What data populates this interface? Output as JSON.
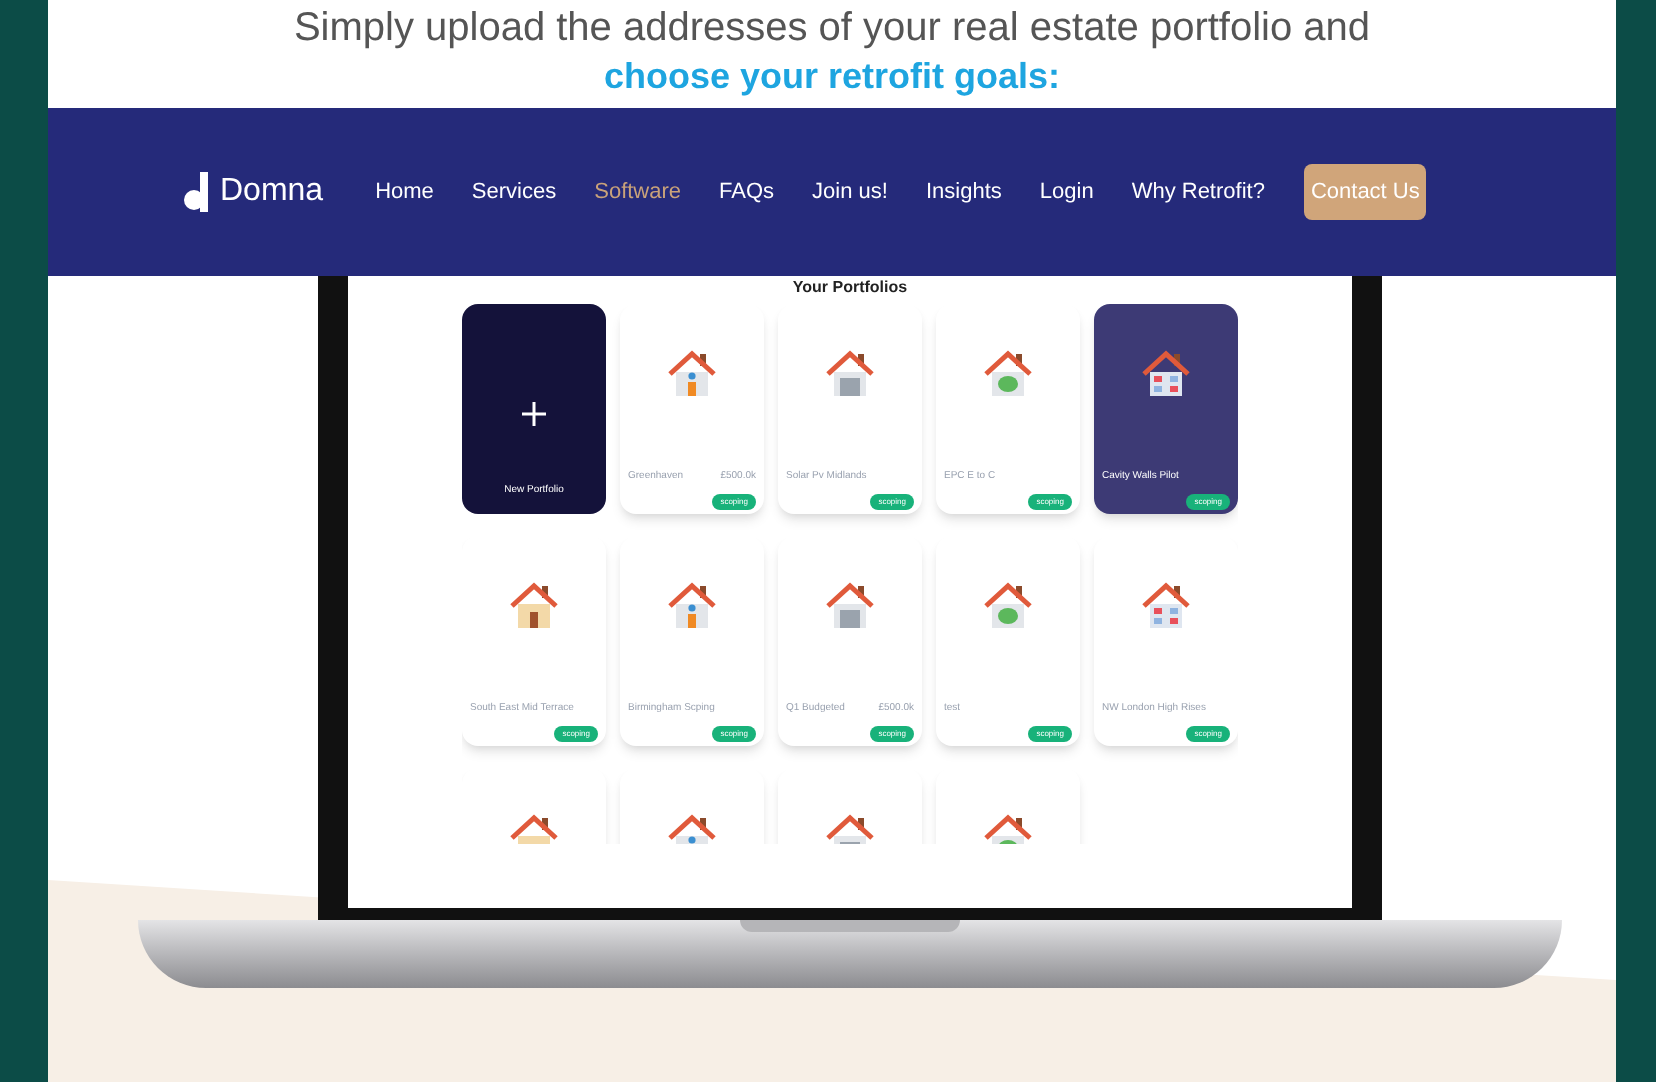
{
  "headline": {
    "line_1": "Simply upload the addresses of your real estate portfolio and",
    "line_2": "choose your retrofit goals:"
  },
  "nav": {
    "logo": "Domna",
    "items": [
      {
        "label": "Home",
        "selected": false
      },
      {
        "label": "Services",
        "selected": false
      },
      {
        "label": "Software",
        "selected": true
      },
      {
        "label": "FAQs",
        "selected": false
      },
      {
        "label": "Join us!",
        "selected": false
      },
      {
        "label": "Insights",
        "selected": false
      },
      {
        "label": "Login",
        "selected": false
      },
      {
        "label": "Why Retrofit?",
        "selected": false
      }
    ],
    "button": "Contact Us"
  },
  "app": {
    "title": "Your Portfolios",
    "cards": [
      {
        "kind": "new",
        "label": "New Portfolio",
        "selected": false
      },
      {
        "kind": "portfolio",
        "name": "Greenhaven",
        "budget": "£500.0k",
        "status": "scoping",
        "selected": false
      },
      {
        "kind": "portfolio",
        "name": "Solar Pv Midlands",
        "status": "scoping",
        "selected": false
      },
      {
        "kind": "portfolio",
        "name": "EPC E to C",
        "status": "scoping",
        "selected": false
      },
      {
        "kind": "portfolio",
        "name": "Cavity Walls Pilot",
        "status": "scoping",
        "selected": true
      },
      {
        "kind": "portfolio",
        "name": "South East Mid Terrace",
        "status": "scoping",
        "selected": false
      },
      {
        "kind": "portfolio",
        "name": "Birmingham Scping",
        "status": "scoping",
        "selected": false
      },
      {
        "kind": "portfolio",
        "name": "Q1 Budgeted",
        "budget": "£500.0k",
        "status": "scoping",
        "selected": false
      },
      {
        "kind": "portfolio",
        "name": "test",
        "status": "scoping",
        "selected": false
      },
      {
        "kind": "portfolio",
        "name": "NW London High Rises",
        "status": "scoping",
        "selected": false
      },
      {
        "kind": "portfolio",
        "selected": false
      },
      {
        "kind": "portfolio",
        "selected": false
      },
      {
        "kind": "portfolio",
        "selected": false
      },
      {
        "kind": "portfolio",
        "selected": false
      }
    ]
  }
}
